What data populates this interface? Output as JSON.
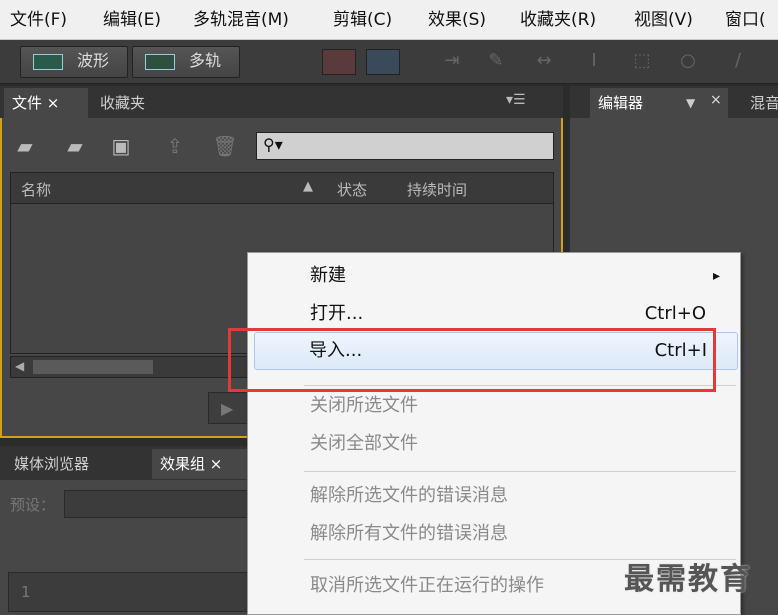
{
  "menubar": [
    "文件(F)",
    "编辑(E)",
    "多轨混音(M)",
    "剪辑(C)",
    "效果(S)",
    "收藏夹(R)",
    "视图(V)",
    "窗口("
  ],
  "toolbar": {
    "waveform_label": "波形",
    "multitrack_label": "多轨"
  },
  "files_panel": {
    "tabs": [
      "文件 ×",
      "收藏夹"
    ],
    "columns": {
      "name": "名称",
      "status": "状态",
      "duration": "持续时间"
    }
  },
  "editor_panel": {
    "tabs": [
      "编辑器",
      "混音"
    ]
  },
  "bottom_panel": {
    "tabs": [
      "媒体浏览器",
      "效果组 ×"
    ],
    "preset_label": "预设：",
    "row_number": "1"
  },
  "context_menu": {
    "items": [
      {
        "label": "新建",
        "shortcut": "",
        "submenu_arrow": "▸"
      },
      {
        "label": "打开...",
        "shortcut": "Ctrl+O"
      },
      {
        "label": "导入...",
        "shortcut": "Ctrl+I"
      },
      {
        "label": "关闭所选文件",
        "shortcut": ""
      },
      {
        "label": "关闭全部文件",
        "shortcut": ""
      },
      {
        "label": "解除所选文件的错误消息",
        "shortcut": ""
      },
      {
        "label": "解除所有文件的错误消息",
        "shortcut": ""
      },
      {
        "label": "取消所选文件正在运行的操作",
        "shortcut": ""
      }
    ]
  },
  "watermark": "最需教育",
  "colors": {
    "highlight_border": "#e23a3a",
    "panel_outline": "#d4a017"
  }
}
